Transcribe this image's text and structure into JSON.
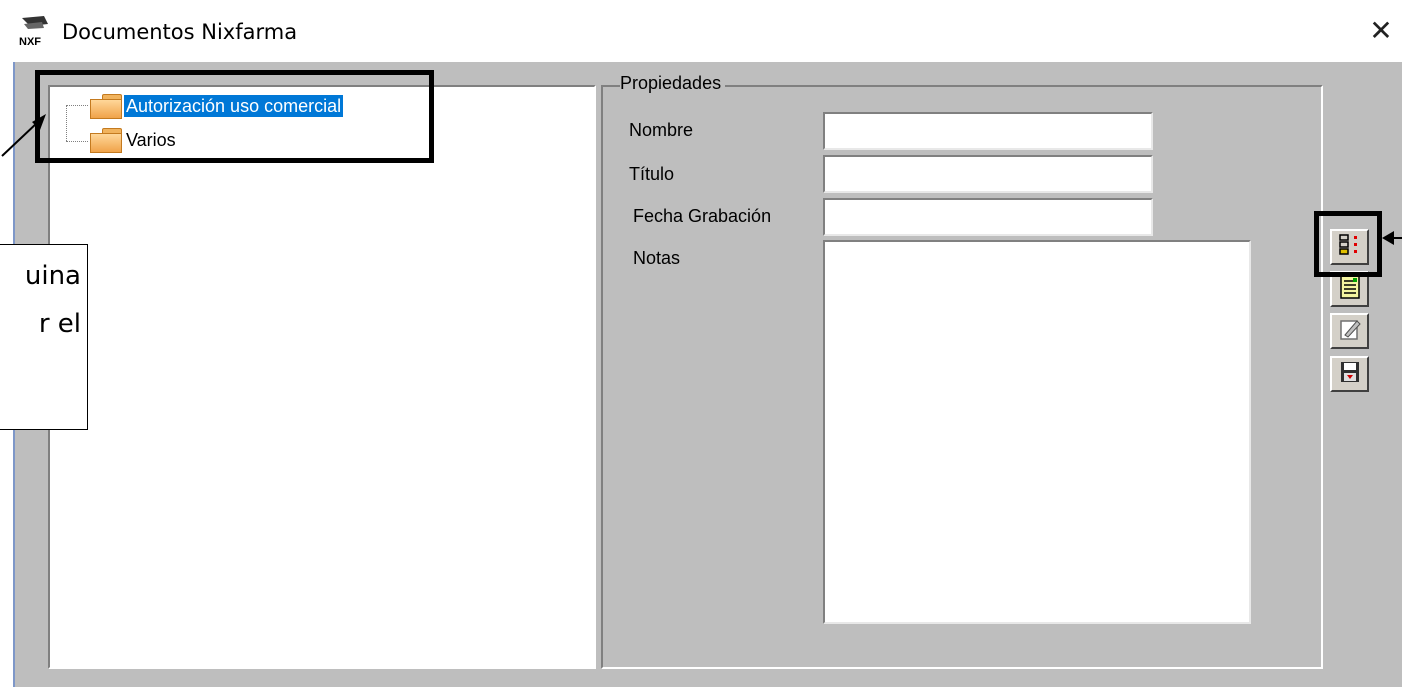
{
  "window": {
    "title": "Documentos Nixfarma",
    "logo_text": "NXF",
    "close_glyph": "✕"
  },
  "tree": {
    "items": [
      {
        "label": "Autorización uso comercial",
        "selected": true
      },
      {
        "label": "Varios",
        "selected": false
      }
    ]
  },
  "properties": {
    "group_label": "Propiedades",
    "nombre_label": "Nombre",
    "nombre_value": "",
    "titulo_label": "Título",
    "titulo_value": "",
    "fecha_label": "Fecha Grabación",
    "fecha_value": "",
    "notas_label": "Notas",
    "notas_value": ""
  },
  "toolbar": {
    "buttons": [
      "view-details-icon",
      "document-note-icon",
      "edit-document-icon",
      "save-icon"
    ]
  },
  "annotation": {
    "callout_line1": "uina",
    "callout_line2": "r el"
  },
  "colors": {
    "selection": "#0078d7",
    "client_bg": "#bebebe",
    "folder": "#f0a34a"
  }
}
